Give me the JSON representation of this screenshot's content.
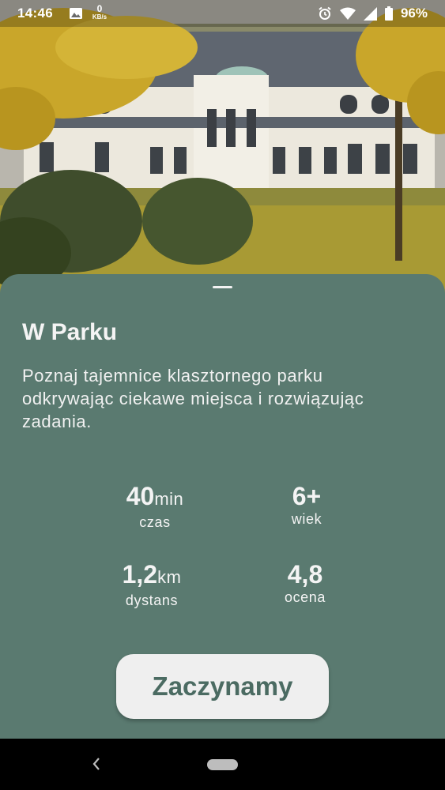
{
  "status_bar": {
    "time": "14:46",
    "net_speed_value": "0",
    "net_speed_unit": "KB/s",
    "battery": "96%",
    "icons": [
      "image-icon",
      "alarm-icon",
      "wifi-icon",
      "signal-icon",
      "battery-icon"
    ]
  },
  "hero": {
    "image": "manor-house-in-autumn-park-photo"
  },
  "sheet": {
    "title": "W Parku",
    "description": "Poznaj tajemnice klasztornego parku odkrywając ciekawe miejsca i rozwiązując zadania.",
    "stats": {
      "time": {
        "value": "40",
        "unit": "min",
        "label": "czas"
      },
      "age": {
        "value": "6+",
        "unit": "",
        "label": "wiek"
      },
      "distance": {
        "value": "1,2",
        "unit": "km",
        "label": "dystans"
      },
      "rating": {
        "value": "4,8",
        "unit": "",
        "label": "ocena"
      }
    },
    "start_button": "Zaczynamy"
  },
  "nav_bar": {
    "icons": [
      "back-icon",
      "home-pill-icon"
    ]
  },
  "colors": {
    "sheet_background": "#5a7a70",
    "button_background": "#efefef",
    "button_text": "#4b6b62",
    "text": "#f4f4f4"
  }
}
